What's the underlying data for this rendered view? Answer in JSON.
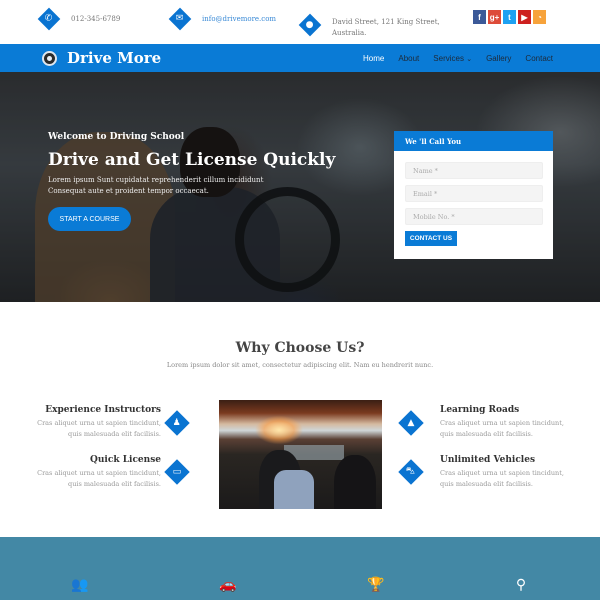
{
  "topbar": {
    "phone": {
      "icon": "phone-icon",
      "text": "012-345-6789"
    },
    "email": {
      "icon": "envelope-icon",
      "text": "info@drivemore.com"
    },
    "address": {
      "icon": "map-marker-icon",
      "line1": "David Street, 121 King Street,",
      "line2": "Australia."
    },
    "social": [
      {
        "name": "facebook",
        "glyph": "f",
        "color": "#3b5998"
      },
      {
        "name": "google-plus",
        "glyph": "g+",
        "color": "#dd4b39"
      },
      {
        "name": "twitter",
        "glyph": "t",
        "color": "#1da1f2"
      },
      {
        "name": "youtube",
        "glyph": "▶",
        "color": "#cd201f"
      },
      {
        "name": "rss",
        "glyph": "◔",
        "color": "#f7a33b"
      }
    ]
  },
  "nav": {
    "brand": "Drive More",
    "items": [
      "Home",
      "About",
      "Services",
      "Gallery",
      "Contact"
    ],
    "active": "Home",
    "services_caret": "⌄"
  },
  "hero": {
    "subtitle": "Welcome to Driving School",
    "title": "Drive and Get License Quickly",
    "desc_line1": "Lorem ipsum Sunt cupidatat reprehenderit cillum incididunt",
    "desc_line2": "Consequat aute et proident tempor occaecat.",
    "button": "START A COURSE"
  },
  "form": {
    "title": "We 'll Call You",
    "name_placeholder": "Name *",
    "email_placeholder": "Email *",
    "mobile_placeholder": "Mobile No. *",
    "button": "CONTACT US"
  },
  "why": {
    "title": "Why Choose Us?",
    "subtitle": "Lorem ipsum dolor sit amet, consectetur adipiscing elit. Nam eu hendrerit nunc.",
    "features": [
      {
        "title": "Experience Instructors",
        "line1": "Cras aliquet urna ut sapien tincidunt,",
        "line2": "quis malesuada elit facilisis.",
        "icon": "instructor-icon"
      },
      {
        "title": "Quick License",
        "line1": "Cras aliquet urna ut sapien tincidunt,",
        "line2": "quis malesuada elit facilisis.",
        "icon": "credit-card-icon"
      },
      {
        "title": "Learning Roads",
        "line1": "Cras aliquet urna ut sapien tincidunt,",
        "line2": "quis malesuada elit facilisis.",
        "icon": "road-icon"
      },
      {
        "title": "Unlimited Vehicles",
        "line1": "Cras aliquet urna ut sapien tincidunt,",
        "line2": "quis malesuada elit facilisis.",
        "icon": "car-icon"
      }
    ]
  },
  "band": {
    "icons": [
      "users-icon",
      "car-icon",
      "trophy-icon",
      "map-marker-icon"
    ]
  },
  "colors": {
    "brand_blue": "#0a7bd6",
    "band_blue": "#4388a5"
  }
}
